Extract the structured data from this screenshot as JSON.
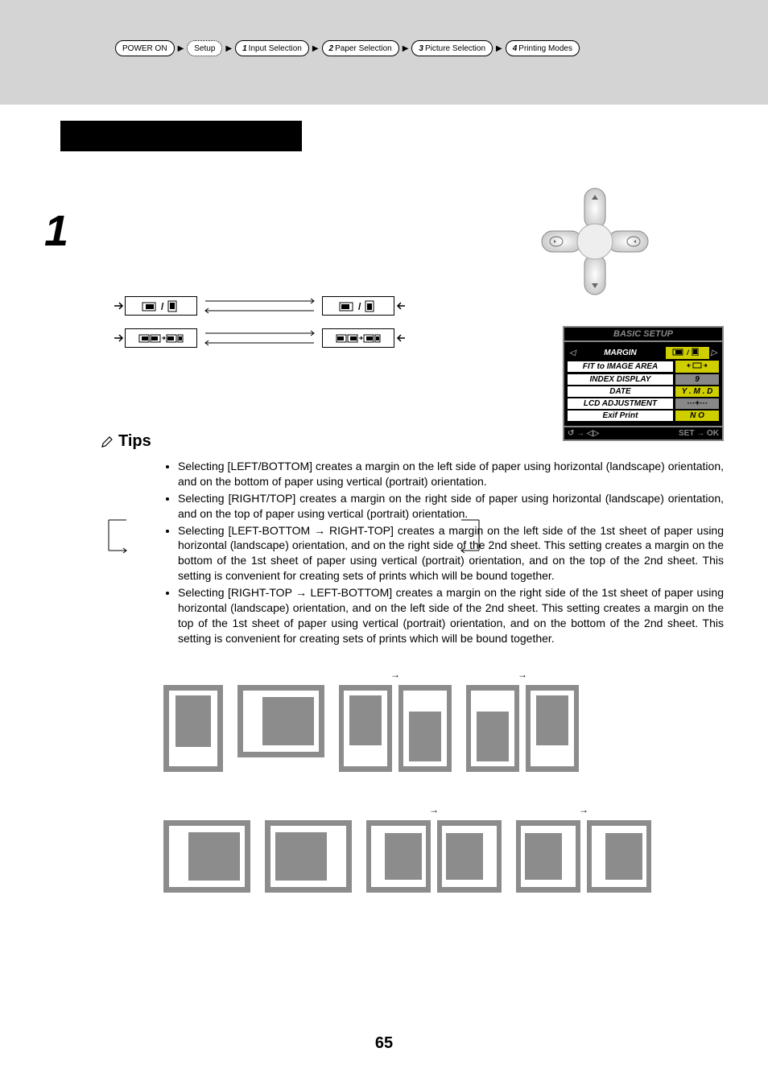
{
  "breadcrumb": {
    "items": [
      {
        "num": "",
        "label": "POWER ON"
      },
      {
        "num": "",
        "label": "Setup"
      },
      {
        "num": "1",
        "label": "Input Selection"
      },
      {
        "num": "2",
        "label": "Paper Selection"
      },
      {
        "num": "3",
        "label": "Picture Selection"
      },
      {
        "num": "4",
        "label": "Printing Modes"
      }
    ]
  },
  "step_number": "1",
  "lcd": {
    "title": "BASIC SETUP",
    "rows": [
      {
        "label": "MARGIN",
        "value": "□ / □",
        "active": true,
        "hl": true
      },
      {
        "label": "FIT to IMAGE AREA",
        "value": "⟷",
        "hl": true
      },
      {
        "label": "INDEX DISPLAY",
        "value": "9"
      },
      {
        "label": "DATE",
        "value": "Y . M . D",
        "hl": true
      },
      {
        "label": "LCD ADJUSTMENT",
        "value": "···+···"
      },
      {
        "label": "Exif Print",
        "value": "N O",
        "hl": true
      }
    ],
    "foot_left": "↺ → ◁▷",
    "foot_right": "SET → OK"
  },
  "tips": {
    "heading": "Tips",
    "items": [
      "Selecting [LEFT/BOTTOM] creates a margin on the left side of paper using horizontal (landscape) orientation, and on the bottom of paper using vertical (portrait) orientation.",
      "Selecting [RIGHT/TOP] creates a margin on the right side of paper using horizontal (landscape) orientation, and on the top of paper using vertical (portrait) orientation.",
      "Selecting [LEFT-BOTTOM → RIGHT-TOP] creates a margin on the left side of the 1st sheet of paper using horizontal (landscape) orientation, and on the right side of the 2nd sheet. This setting creates a margin on the bottom of the 1st sheet of paper using vertical (portrait) orientation, and on the top of the 2nd sheet. This setting is convenient for creating sets of prints which will be bound together.",
      "Selecting [RIGHT-TOP → LEFT-BOTTOM] creates a margin on the right side of the 1st sheet of paper using horizontal (landscape) orientation, and on the left side of the 2nd sheet. This setting creates a margin on the top of the 1st sheet of paper using vertical (portrait) orientation, and on the bottom of the 2nd sheet. This setting is convenient for creating sets of prints which will be bound together."
    ]
  },
  "examples": {
    "row1_labels": [
      "",
      "",
      "→",
      "→"
    ],
    "row2_labels": [
      "",
      "",
      "→",
      "→"
    ]
  },
  "page_number": "65"
}
